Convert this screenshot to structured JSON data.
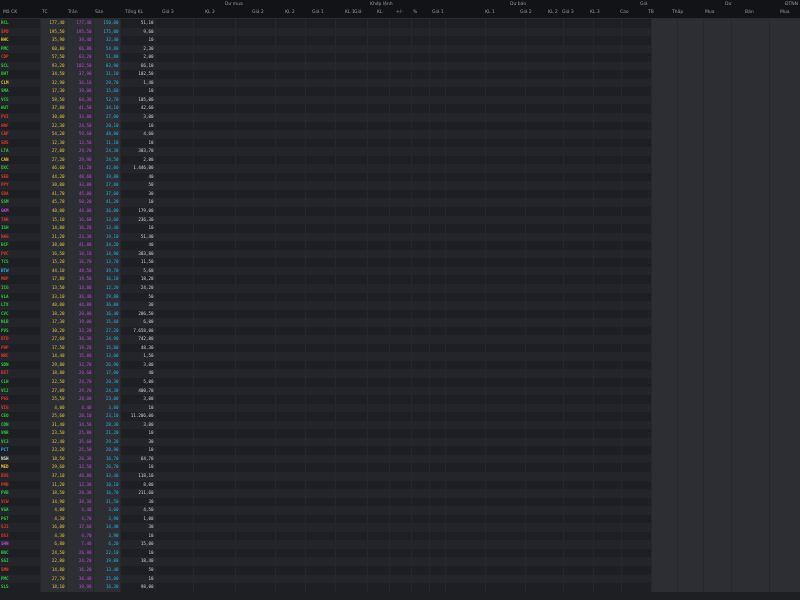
{
  "header": {
    "groups": [
      "Dư mua",
      "Khớp lệnh",
      "Dư bán",
      "Giá",
      "Dư",
      "ĐTNN"
    ],
    "columns": [
      "Mã CK",
      "TC",
      "Trần",
      "Sàn",
      "Tổng KL",
      "Giá 3",
      "KL 3",
      "Giá 2",
      "KL 2",
      "Giá 1",
      "KL 1",
      "Giá",
      "KL",
      "+/-",
      "%",
      "Giá 1",
      "KL 1",
      "Giá 2",
      "KL 2",
      "Giá 3",
      "KL 3",
      "Cao",
      "TB",
      "Thấp",
      "Mua",
      "Bán",
      "Mua"
    ]
  },
  "rows": [
    {
      "s": "RCL",
      "r": "177,40",
      "c": "177,40",
      "f": "150,00",
      "v": "51,10",
      "t": "up"
    },
    {
      "s": "SPD",
      "r": "195,50",
      "c": "195,50",
      "f": "175,00",
      "v": "9,60",
      "t": "dn"
    },
    {
      "s": "HHC",
      "r": "35,90",
      "c": "39,40",
      "f": "32,40",
      "v": "10",
      "t": "ref"
    },
    {
      "s": "PMC",
      "r": "60,80",
      "c": "66,80",
      "f": "54,80",
      "v": "2,30",
      "t": "up"
    },
    {
      "s": "CDP",
      "r": "57,50",
      "c": "63,20",
      "f": "51,80",
      "v": "2,00",
      "t": "dn"
    },
    {
      "s": "SCL",
      "r": "93,20",
      "c": "102,50",
      "f": "83,90",
      "v": "66,10",
      "t": "up"
    },
    {
      "s": "DHT",
      "r": "34,50",
      "c": "37,90",
      "f": "31,10",
      "v": "102,50",
      "t": "up"
    },
    {
      "s": "CLM",
      "r": "32,90",
      "c": "36,10",
      "f": "29,70",
      "v": "1,40",
      "t": "ref"
    },
    {
      "s": "SMA",
      "r": "17,30",
      "c": "19,00",
      "f": "15,60",
      "v": "10",
      "t": "up"
    },
    {
      "s": "VCS",
      "r": "58,50",
      "c": "64,30",
      "f": "52,70",
      "v": "105,00",
      "t": "up"
    },
    {
      "s": "HUT",
      "r": "37,80",
      "c": "41,50",
      "f": "34,10",
      "v": "42,60",
      "t": "up"
    },
    {
      "s": "PVI",
      "r": "30,00",
      "c": "33,00",
      "f": "27,00",
      "v": "3,00",
      "t": "dn"
    },
    {
      "s": "HNF",
      "r": "22,30",
      "c": "24,50",
      "f": "20,10",
      "v": "10",
      "t": "dn"
    },
    {
      "s": "CAP",
      "r": "54,20",
      "c": "59,60",
      "f": "48,80",
      "v": "4,60",
      "t": "dn"
    },
    {
      "s": "SD5",
      "r": "12,30",
      "c": "13,50",
      "f": "11,10",
      "v": "10",
      "t": "dn"
    },
    {
      "s": "LTA",
      "r": "27,00",
      "c": "29,70",
      "f": "24,30",
      "v": "303,70",
      "t": "up"
    },
    {
      "s": "CAN",
      "r": "27,20",
      "c": "29,90",
      "f": "24,50",
      "v": "2,00",
      "t": "ref"
    },
    {
      "s": "DXC",
      "r": "46,60",
      "c": "51,20",
      "f": "42,00",
      "v": "1.446,00",
      "t": "up"
    },
    {
      "s": "SEB",
      "r": "44,20",
      "c": "48,60",
      "f": "39,80",
      "v": "40",
      "t": "dn"
    },
    {
      "s": "PPY",
      "r": "30,00",
      "c": "33,00",
      "f": "27,00",
      "v": "50",
      "t": "dn"
    },
    {
      "s": "SDA",
      "r": "41,70",
      "c": "45,80",
      "f": "37,60",
      "v": "30",
      "t": "dn"
    },
    {
      "s": "SSM",
      "r": "45,70",
      "c": "50,20",
      "f": "41,20",
      "v": "10",
      "t": "up"
    },
    {
      "s": "GKM",
      "r": "40,00",
      "c": "44,00",
      "f": "36,00",
      "v": "179,00",
      "t": "ce"
    },
    {
      "s": "TAR",
      "r": "15,10",
      "c": "16,60",
      "f": "13,60",
      "v": "236,30",
      "t": "dn"
    },
    {
      "s": "ISH",
      "r": "14,80",
      "c": "16,20",
      "f": "13,40",
      "v": "10",
      "t": "up"
    },
    {
      "s": "NAG",
      "r": "21,20",
      "c": "23,30",
      "f": "19,10",
      "v": "51,40",
      "t": "dn"
    },
    {
      "s": "BCF",
      "r": "38,00",
      "c": "41,80",
      "f": "34,20",
      "v": "40",
      "t": "up"
    },
    {
      "s": "PVC",
      "r": "16,50",
      "c": "18,10",
      "f": "14,90",
      "v": "303,80",
      "t": "dn"
    },
    {
      "s": "TCS",
      "r": "15,20",
      "c": "16,70",
      "f": "13,70",
      "v": "11,50",
      "t": "up"
    },
    {
      "s": "BTW",
      "r": "44,10",
      "c": "48,50",
      "f": "39,70",
      "v": "5,60",
      "t": "fl"
    },
    {
      "s": "MBP",
      "r": "17,80",
      "c": "19,50",
      "f": "16,10",
      "v": "18,20",
      "t": "dn"
    },
    {
      "s": "ICG",
      "r": "13,50",
      "c": "14,80",
      "f": "12,20",
      "v": "24,20",
      "t": "up"
    },
    {
      "s": "VLA",
      "r": "33,10",
      "c": "36,40",
      "f": "29,80",
      "v": "50",
      "t": "up"
    },
    {
      "s": "LTX",
      "r": "40,00",
      "c": "44,00",
      "f": "36,00",
      "v": "30",
      "t": "up"
    },
    {
      "s": "CVC",
      "r": "18,20",
      "c": "20,00",
      "f": "16,40",
      "v": "206,50",
      "t": "up"
    },
    {
      "s": "NLB",
      "r": "17,30",
      "c": "19,00",
      "f": "15,60",
      "v": "6,00",
      "t": "up"
    },
    {
      "s": "PVS",
      "r": "30,20",
      "c": "33,20",
      "f": "27,20",
      "v": "7.658,00",
      "t": "up"
    },
    {
      "s": "DTD",
      "r": "27,60",
      "c": "30,30",
      "f": "24,90",
      "v": "742,80",
      "t": "dn"
    },
    {
      "s": "PHP",
      "r": "17,50",
      "c": "19,20",
      "f": "15,80",
      "v": "48,30",
      "t": "dn"
    },
    {
      "s": "NRC",
      "r": "14,40",
      "c": "15,80",
      "f": "13,00",
      "v": "1,50",
      "t": "dn"
    },
    {
      "s": "SDN",
      "r": "29,80",
      "c": "32,70",
      "f": "26,90",
      "v": "3,00",
      "t": "up"
    },
    {
      "s": "BST",
      "r": "18,80",
      "c": "20,60",
      "f": "17,00",
      "v": "40",
      "t": "dn"
    },
    {
      "s": "CLH",
      "r": "22,50",
      "c": "24,70",
      "f": "20,30",
      "v": "5,00",
      "t": "up"
    },
    {
      "s": "VCJ",
      "r": "27,00",
      "c": "29,70",
      "f": "24,30",
      "v": "400,70",
      "t": "up"
    },
    {
      "s": "PGS",
      "r": "25,50",
      "c": "28,00",
      "f": "23,00",
      "v": "3,00",
      "t": "dn"
    },
    {
      "s": "VIG",
      "r": "4,00",
      "c": "4,40",
      "f": "3,60",
      "v": "10",
      "t": "dn"
    },
    {
      "s": "CEO",
      "r": "25,60",
      "c": "28,10",
      "f": "23,10",
      "v": "11.206,00",
      "t": "up"
    },
    {
      "s": "CDN",
      "r": "31,40",
      "c": "34,50",
      "f": "28,30",
      "v": "3,00",
      "t": "up"
    },
    {
      "s": "VNR",
      "r": "23,50",
      "c": "25,80",
      "f": "21,20",
      "v": "10",
      "t": "up"
    },
    {
      "s": "VC3",
      "r": "32,40",
      "c": "35,60",
      "f": "29,20",
      "v": "30",
      "t": "up"
    },
    {
      "s": "PCT",
      "r": "23,20",
      "c": "25,50",
      "f": "20,90",
      "v": "10",
      "t": "fl"
    },
    {
      "s": "NSH",
      "r": "18,50",
      "c": "20,30",
      "f": "16,70",
      "v": "64,70",
      "t": "wh"
    },
    {
      "s": "MED",
      "r": "29,60",
      "c": "32,50",
      "f": "26,70",
      "v": "10",
      "t": "ref"
    },
    {
      "s": "BVS",
      "r": "37,10",
      "c": "40,80",
      "f": "33,40",
      "v": "118,10",
      "t": "dn"
    },
    {
      "s": "PMB",
      "r": "11,20",
      "c": "12,30",
      "f": "10,10",
      "v": "8,00",
      "t": "dn"
    },
    {
      "s": "PVB",
      "r": "18,50",
      "c": "20,30",
      "f": "16,70",
      "v": "211,60",
      "t": "up"
    },
    {
      "s": "VCW",
      "r": "34,90",
      "c": "38,30",
      "f": "31,50",
      "v": "30",
      "t": "dn"
    },
    {
      "s": "VGA",
      "r": "4,00",
      "c": "4,40",
      "f": "3,60",
      "v": "4,50",
      "t": "up"
    },
    {
      "s": "PGT",
      "r": "4,30",
      "c": "4,70",
      "f": "3,90",
      "v": "1,00",
      "t": "up"
    },
    {
      "s": "SJ1",
      "r": "16,00",
      "c": "17,60",
      "f": "14,40",
      "v": "30",
      "t": "dn"
    },
    {
      "s": "DS3",
      "r": "4,30",
      "c": "4,70",
      "f": "3,90",
      "v": "10",
      "t": "dn"
    },
    {
      "s": "SHN",
      "r": "6,80",
      "c": "7,40",
      "f": "6,20",
      "v": "15,00",
      "t": "ce"
    },
    {
      "s": "BNC",
      "r": "24,50",
      "c": "26,90",
      "f": "22,10",
      "v": "10",
      "t": "up"
    },
    {
      "s": "SGI",
      "r": "22,00",
      "c": "24,20",
      "f": "19,80",
      "v": "18,40",
      "t": "up"
    },
    {
      "s": "SMN",
      "r": "14,80",
      "c": "16,20",
      "f": "13,40",
      "v": "50",
      "t": "dn"
    },
    {
      "s": "PMC",
      "r": "27,70",
      "c": "30,40",
      "f": "25,00",
      "v": "10",
      "t": "up"
    },
    {
      "s": "SLS",
      "r": "18,10",
      "c": "19,90",
      "f": "16,30",
      "v": "98,00",
      "t": "up"
    }
  ]
}
